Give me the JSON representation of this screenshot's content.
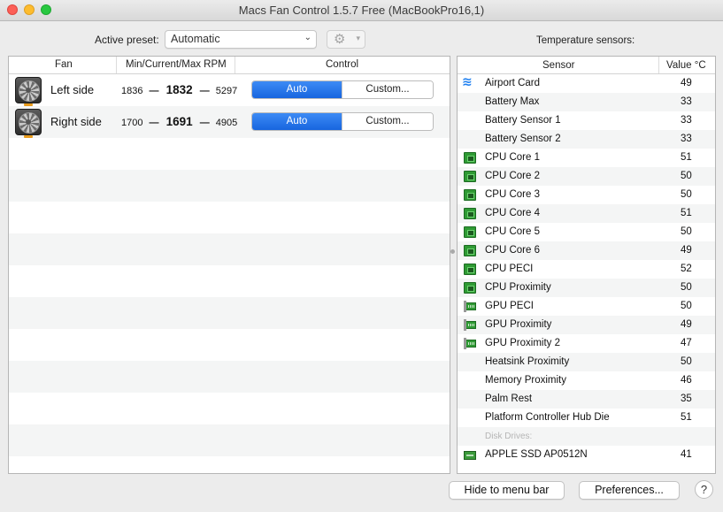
{
  "window": {
    "title": "Macs Fan Control 1.5.7 Free (MacBookPro16,1)"
  },
  "toolbar": {
    "preset_label": "Active preset:",
    "preset_value": "Automatic",
    "sensors_title": "Temperature sensors:"
  },
  "fan_table": {
    "headers": [
      "Fan",
      "Min/Current/Max RPM",
      "Control"
    ],
    "rows": [
      {
        "name": "Left side",
        "min": "1836",
        "current": "1832",
        "max": "5297",
        "auto_label": "Auto",
        "custom_label": "Custom..."
      },
      {
        "name": "Right side",
        "min": "1700",
        "current": "1691",
        "max": "4905",
        "auto_label": "Auto",
        "custom_label": "Custom..."
      }
    ],
    "dash": "—"
  },
  "sensor_table": {
    "headers": [
      "Sensor",
      "Value °C"
    ],
    "rows": [
      {
        "label": "Airport Card",
        "value": "49",
        "icon": "wifi-icon"
      },
      {
        "label": "Battery Max",
        "value": "33",
        "icon": ""
      },
      {
        "label": "Battery Sensor 1",
        "value": "33",
        "icon": ""
      },
      {
        "label": "Battery Sensor 2",
        "value": "33",
        "icon": ""
      },
      {
        "label": "CPU Core 1",
        "value": "51",
        "icon": "cpu-chip-icon"
      },
      {
        "label": "CPU Core 2",
        "value": "50",
        "icon": "cpu-chip-icon"
      },
      {
        "label": "CPU Core 3",
        "value": "50",
        "icon": "cpu-chip-icon"
      },
      {
        "label": "CPU Core 4",
        "value": "51",
        "icon": "cpu-chip-icon"
      },
      {
        "label": "CPU Core 5",
        "value": "50",
        "icon": "cpu-chip-icon"
      },
      {
        "label": "CPU Core 6",
        "value": "49",
        "icon": "cpu-chip-icon"
      },
      {
        "label": "CPU PECI",
        "value": "52",
        "icon": "cpu-chip-icon"
      },
      {
        "label": "CPU Proximity",
        "value": "50",
        "icon": "cpu-chip-icon"
      },
      {
        "label": "GPU PECI",
        "value": "50",
        "icon": "gpu-card-icon"
      },
      {
        "label": "GPU Proximity",
        "value": "49",
        "icon": "gpu-card-icon"
      },
      {
        "label": "GPU Proximity 2",
        "value": "47",
        "icon": "gpu-card-icon"
      },
      {
        "label": "Heatsink Proximity",
        "value": "50",
        "icon": ""
      },
      {
        "label": "Memory Proximity",
        "value": "46",
        "icon": ""
      },
      {
        "label": "Palm Rest",
        "value": "35",
        "icon": ""
      },
      {
        "label": "Platform Controller Hub Die",
        "value": "51",
        "icon": ""
      },
      {
        "label": "Disk Drives:",
        "value": "",
        "icon": "",
        "group": true
      },
      {
        "label": "APPLE SSD AP0512N",
        "value": "41",
        "icon": "ssd-icon"
      }
    ]
  },
  "buttons": {
    "hide": "Hide to menu bar",
    "preferences": "Preferences...",
    "help": "?"
  },
  "colors": {
    "accent": "#1765df",
    "chip": "#2f9a34",
    "wifi": "#1d7ff0"
  }
}
